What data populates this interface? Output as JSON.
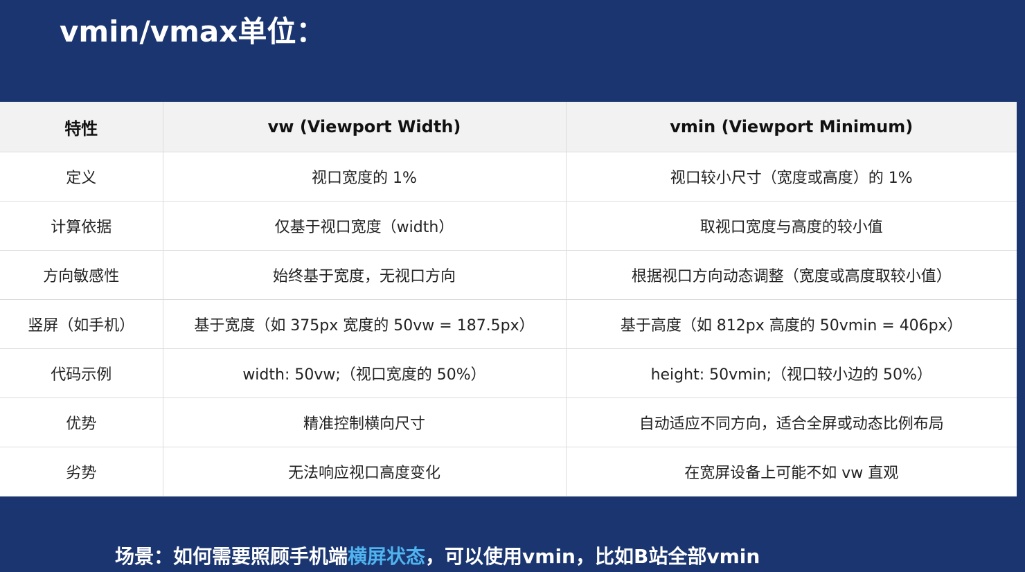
{
  "title": "vmin/vmax单位：",
  "table": {
    "headers": [
      "特性",
      "vw (Viewport Width)",
      "vmin (Viewport Minimum)"
    ],
    "rows": [
      [
        "定义",
        "视口宽度的 1%",
        "视口较小尺寸（宽度或高度）的 1%"
      ],
      [
        "计算依据",
        "仅基于视口宽度（width）",
        "取视口宽度与高度的较小值"
      ],
      [
        "方向敏感性",
        "始终基于宽度，无视口方向",
        "根据视口方向动态调整（宽度或高度取较小值）"
      ],
      [
        "竖屏（如手机）",
        "基于宽度（如 375px 宽度的 50vw = 187.5px）",
        "基于高度（如 812px 高度的 50vmin = 406px）"
      ],
      [
        "代码示例",
        "width: 50vw;（视口宽度的 50%）",
        "height: 50vmin;（视口较小边的 50%）"
      ],
      [
        "优势",
        "精准控制横向尺寸",
        "自动适应不同方向，适合全屏或动态比例布局"
      ],
      [
        "劣势",
        "无法响应视口高度变化",
        "在宽屏设备上可能不如 vw 直观"
      ]
    ]
  },
  "scenario": {
    "prefix": "场景：如何需要照顾手机端",
    "highlight": "横屏状态",
    "suffix": "，可以使用vmin，比如B站全部vmin"
  },
  "colors": {
    "background": "#1a3570",
    "highlight": "#4fb3ef",
    "header_bg": "#f2f2f2"
  }
}
